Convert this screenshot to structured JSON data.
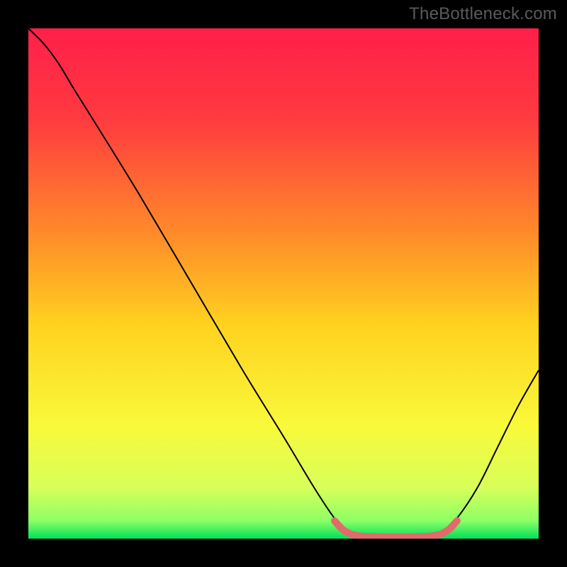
{
  "watermark": "TheBottleneck.com",
  "chart_data": {
    "type": "line",
    "title": "",
    "xlabel": "",
    "ylabel": "",
    "xlim": [
      0,
      100
    ],
    "ylim": [
      0,
      100
    ],
    "grid": false,
    "legend": false,
    "gradient_stops": [
      {
        "offset": 0.0,
        "color": "#ff1f4a"
      },
      {
        "offset": 0.18,
        "color": "#ff3b3f"
      },
      {
        "offset": 0.4,
        "color": "#ff8a2a"
      },
      {
        "offset": 0.58,
        "color": "#ffd21f"
      },
      {
        "offset": 0.78,
        "color": "#f9f93a"
      },
      {
        "offset": 0.9,
        "color": "#d8ff5a"
      },
      {
        "offset": 0.965,
        "color": "#8dff66"
      },
      {
        "offset": 1.0,
        "color": "#00e05a"
      }
    ],
    "series": [
      {
        "name": "bottleneck-curve",
        "stroke": "#000000",
        "stroke_width": 2,
        "points": [
          {
            "x": 0,
            "y": 100
          },
          {
            "x": 3,
            "y": 97
          },
          {
            "x": 6,
            "y": 93
          },
          {
            "x": 9,
            "y": 88
          },
          {
            "x": 14,
            "y": 80
          },
          {
            "x": 22,
            "y": 67
          },
          {
            "x": 32,
            "y": 50
          },
          {
            "x": 42,
            "y": 33
          },
          {
            "x": 50,
            "y": 20
          },
          {
            "x": 56,
            "y": 10
          },
          {
            "x": 60,
            "y": 4
          },
          {
            "x": 63,
            "y": 1
          },
          {
            "x": 66,
            "y": 0
          },
          {
            "x": 72,
            "y": 0
          },
          {
            "x": 78,
            "y": 0
          },
          {
            "x": 81,
            "y": 1
          },
          {
            "x": 84,
            "y": 4
          },
          {
            "x": 88,
            "y": 10
          },
          {
            "x": 92,
            "y": 18
          },
          {
            "x": 96,
            "y": 26
          },
          {
            "x": 100,
            "y": 33
          }
        ]
      },
      {
        "name": "sweet-spot-band",
        "stroke": "#e26a6a",
        "stroke_width": 10,
        "linecap": "round",
        "points": [
          {
            "x": 60,
            "y": 3.5
          },
          {
            "x": 62,
            "y": 1.5
          },
          {
            "x": 65,
            "y": 0.5
          },
          {
            "x": 72,
            "y": 0.3
          },
          {
            "x": 79,
            "y": 0.5
          },
          {
            "x": 82,
            "y": 1.5
          },
          {
            "x": 84,
            "y": 3.5
          }
        ]
      }
    ]
  }
}
